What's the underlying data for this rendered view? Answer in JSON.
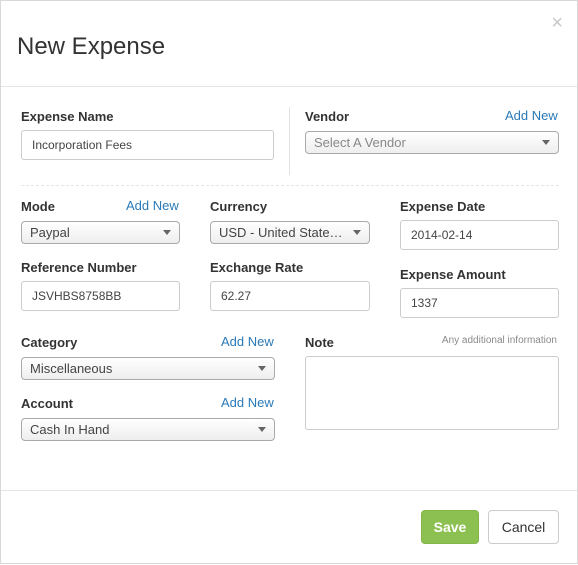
{
  "modal": {
    "title": "New Expense",
    "close_glyph": "×"
  },
  "fields": {
    "expense_name": {
      "label": "Expense Name",
      "value": "Incorporation Fees"
    },
    "vendor": {
      "label": "Vendor",
      "add_new": "Add New",
      "placeholder": "Select A Vendor"
    },
    "mode": {
      "label": "Mode",
      "add_new": "Add New",
      "value": "Paypal"
    },
    "currency": {
      "label": "Currency",
      "value": "USD - United States Dollar"
    },
    "expense_date": {
      "label": "Expense Date",
      "value": "2014-02-14"
    },
    "reference_number": {
      "label": "Reference Number",
      "value": "JSVHBS8758BB"
    },
    "exchange_rate": {
      "label": "Exchange Rate",
      "value": "62.27"
    },
    "expense_amount": {
      "label": "Expense Amount",
      "value": "1337"
    },
    "category": {
      "label": "Category",
      "add_new": "Add New",
      "value": "Miscellaneous"
    },
    "account": {
      "label": "Account",
      "add_new": "Add New",
      "value": "Cash In Hand"
    },
    "note": {
      "label": "Note",
      "hint": "Any additional information",
      "value": ""
    }
  },
  "footer": {
    "save_label": "Save",
    "cancel_label": "Cancel"
  },
  "colors": {
    "accent_link": "#2a7ab8",
    "save_button": "#8cc152"
  },
  "icons": {
    "close": "close-icon",
    "dropdown": "chevron-down-icon"
  }
}
